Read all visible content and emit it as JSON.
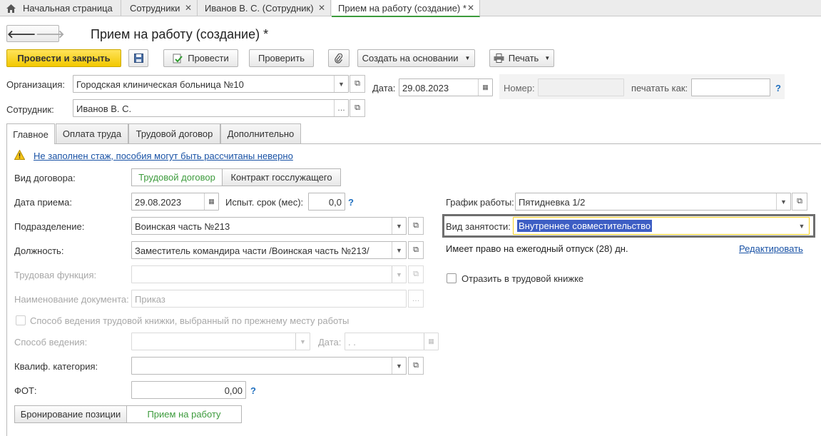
{
  "window_tabs": [
    {
      "label": "Начальная страница",
      "home": true
    },
    {
      "label": "Сотрудники"
    },
    {
      "label": "Иванов В. С. (Сотрудник)"
    },
    {
      "label": "Прием на работу (создание) *",
      "active": true
    }
  ],
  "form_title": "Прием на работу (создание) *",
  "toolbar": {
    "post_close": "Провести и закрыть",
    "post": "Провести",
    "check": "Проверить",
    "create_based": "Создать на основании",
    "print": "Печать"
  },
  "header": {
    "org_label": "Организация:",
    "org_value": "Городская клиническая больница №10",
    "date_label": "Дата:",
    "date_value": "29.08.2023",
    "number_label": "Номер:",
    "number_value": "",
    "print_as_label": "печатать как:",
    "print_as_value": "",
    "employee_label": "Сотрудник:",
    "employee_value": "Иванов В. С."
  },
  "form_tabs": [
    "Главное",
    "Оплата труда",
    "Трудовой договор",
    "Дополнительно"
  ],
  "warning_text": "Не заполнен стаж, пособия могут быть рассчитаны неверно",
  "main": {
    "contract_type_label": "Вид договора:",
    "contract_options": [
      "Трудовой договор",
      "Контракт госслужащего"
    ],
    "hire_date_label": "Дата приема:",
    "hire_date_value": "29.08.2023",
    "probation_label": "Испыт. срок (мес):",
    "probation_value": "0,0",
    "department_label": "Подразделение:",
    "department_value": "Воинская часть №213",
    "position_label": "Должность:",
    "position_value": "Заместитель командира части /Воинская часть №213/",
    "labor_function_label": "Трудовая функция:",
    "labor_function_value": "",
    "doc_name_label": "Наименование документа:",
    "doc_name_value": "Приказ",
    "workbook_prev_label": "Способ ведения трудовой книжки, выбранный по прежнему месту работы",
    "keeping_method_label": "Способ ведения:",
    "keeping_method_value": "",
    "keeping_date_label": "Дата:",
    "keeping_date_value": " .  .",
    "qual_label": "Квалиф. категория:",
    "qual_value": "",
    "fot_label": "ФОТ:",
    "fot_value": "0,00",
    "bottom_options": [
      "Бронирование позиции",
      "Прием на работу"
    ],
    "schedule_label": "График работы:",
    "schedule_value": "Пятидневка 1/2",
    "employment_label": "Вид занятости:",
    "employment_value": "Внутреннее совместительство",
    "vacation_text": "Имеет право на ежегодный отпуск (28) дн.",
    "edit_link": "Редактировать",
    "reflect_label": "Отразить в трудовой книжке"
  },
  "colors": {
    "accent_green": "#3c9b3c",
    "primary_yellow": "#f5cf1f",
    "selection_blue": "#3d5ec4",
    "link_blue": "#1a53a6"
  }
}
